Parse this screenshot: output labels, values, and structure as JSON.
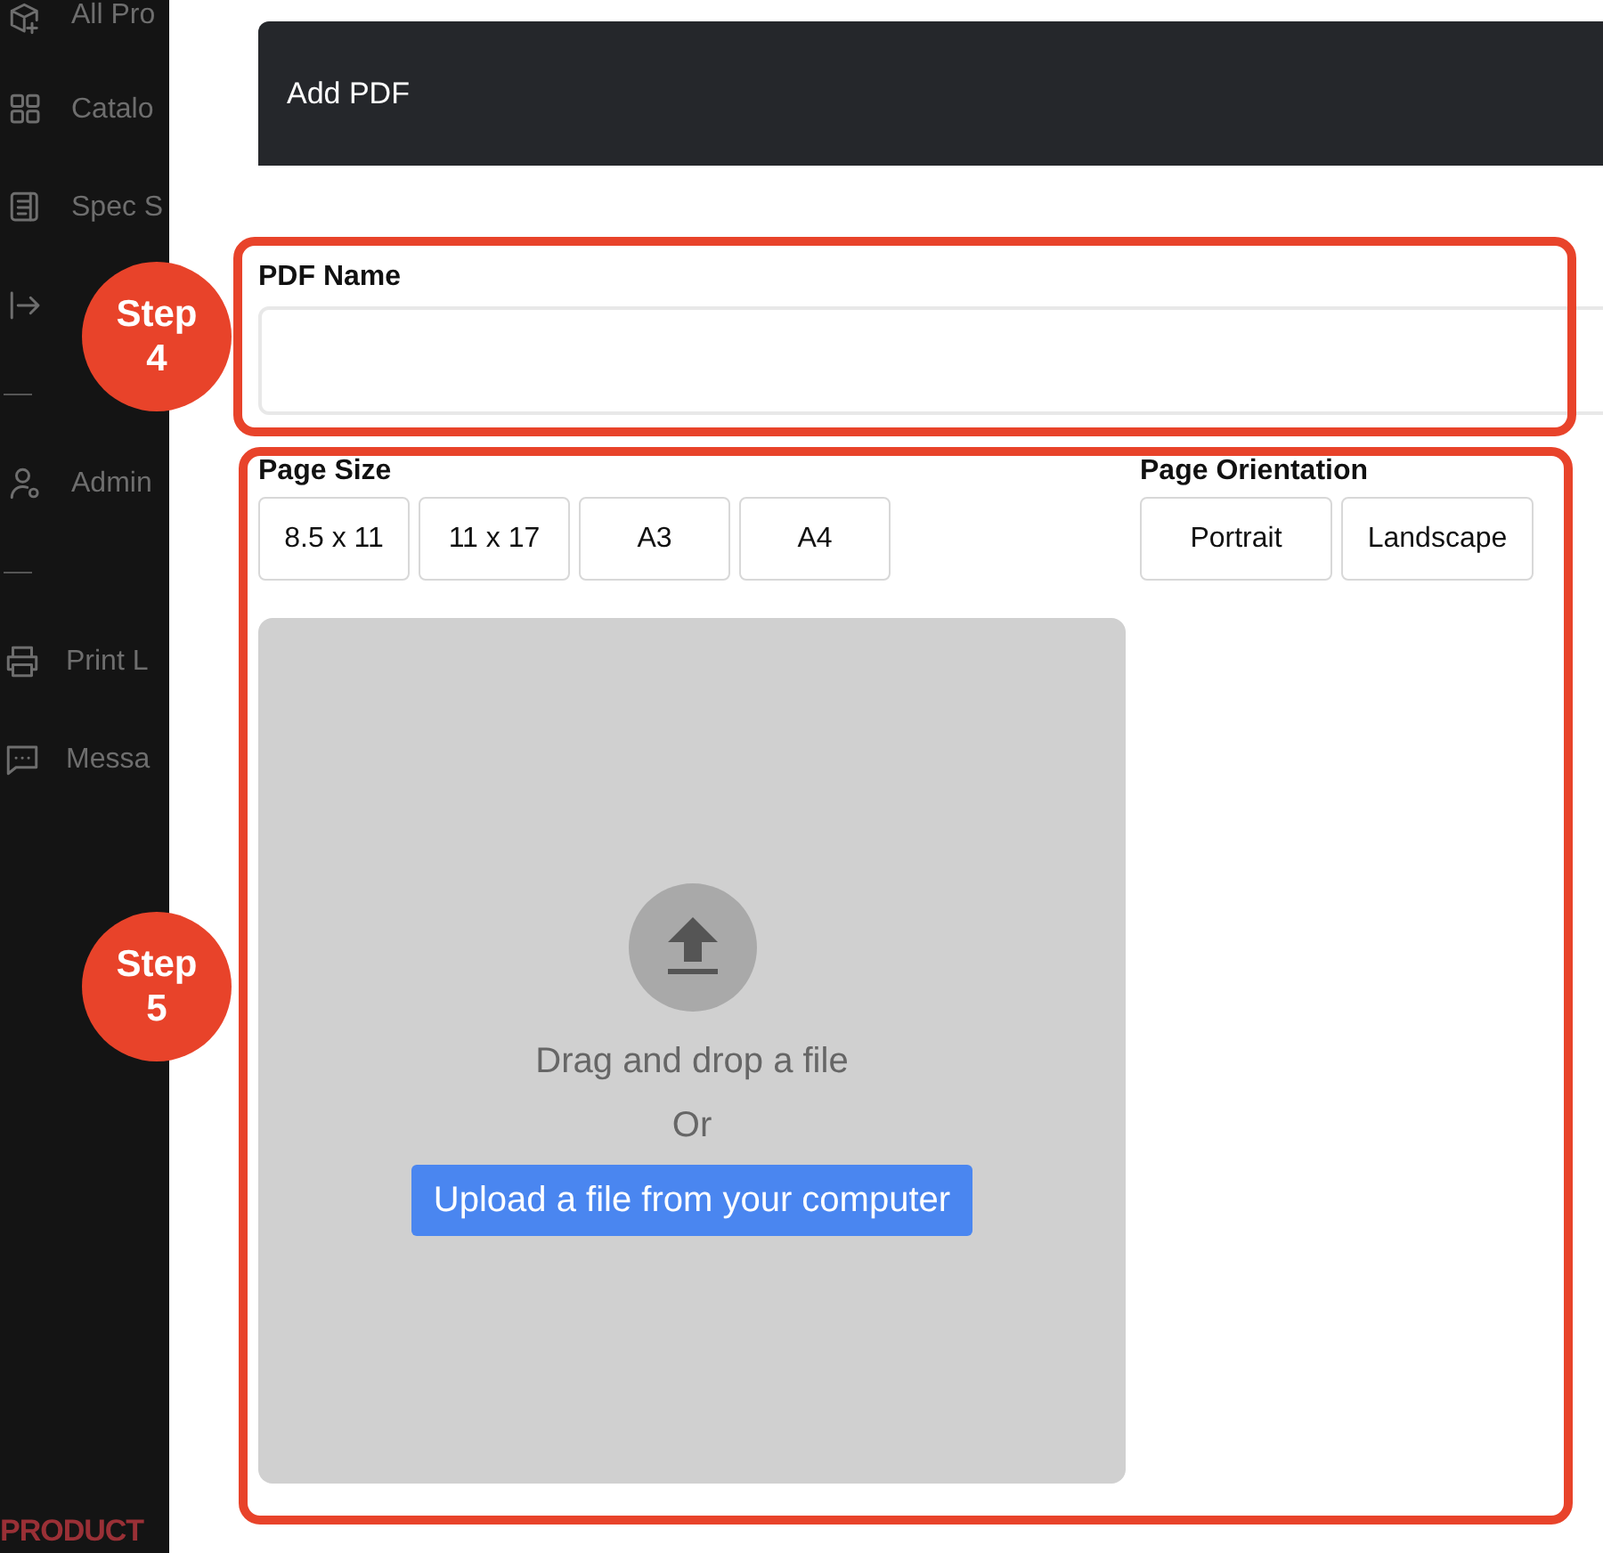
{
  "sidebar": {
    "items": [
      {
        "kind": "item",
        "label": "All Pro"
      },
      {
        "kind": "item",
        "label": "Catalo"
      },
      {
        "kind": "item",
        "label": "Spec S"
      },
      {
        "kind": "item"
      },
      {
        "kind": "divider"
      },
      {
        "kind": "item",
        "label": "Admin"
      },
      {
        "kind": "divider"
      },
      {
        "kind": "item",
        "label": "Print L"
      },
      {
        "kind": "item",
        "label": "Messa"
      }
    ],
    "logo": "PRODUCT"
  },
  "dialog": {
    "title": "Add PDF",
    "pdf_name": {
      "label": "PDF Name"
    },
    "page_size": {
      "label": "Page Size",
      "options": [
        "8.5 x 11",
        "11 x 17",
        "A3",
        "A4"
      ]
    },
    "page_orientation": {
      "label": "Page Orientation",
      "options": [
        "Portrait",
        "Landscape"
      ]
    },
    "dropzone": {
      "text": "Drag and drop a file",
      "or": "Or",
      "button": "Upload a file from your computer"
    }
  },
  "annotations": [
    {
      "label": "Step",
      "number": "4"
    },
    {
      "label": "Step",
      "number": "5"
    }
  ]
}
